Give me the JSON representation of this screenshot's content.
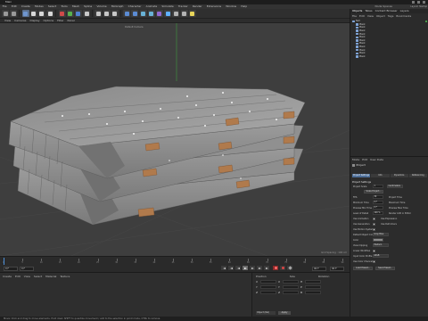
{
  "app": {
    "title": "Main",
    "window_controls": [
      "minimize",
      "maximize",
      "close"
    ]
  },
  "menubar": {
    "items": [
      "File",
      "Edit",
      "Create",
      "Modes",
      "Select",
      "Tools",
      "Mesh",
      "Spline",
      "Volume",
      "MoGraph",
      "Character",
      "Animate",
      "Simulate",
      "Tracker",
      "Render",
      "Extensions",
      "Window",
      "Help"
    ],
    "layout_label": "Node Spaces",
    "layout_value": "Layout: Startup"
  },
  "toolbar": {
    "tools": [
      {
        "name": "undo-icon",
        "color": "#9a9a9a"
      },
      {
        "name": "redo-icon",
        "color": "#9a9a9a"
      },
      {
        "name": "live-selection-icon",
        "color": "#6e95cf",
        "active": true
      },
      {
        "name": "move-icon",
        "color": "#d8d8d8"
      },
      {
        "name": "scale-icon",
        "color": "#d8d8d8"
      },
      {
        "name": "rotate-icon",
        "color": "#d8d8d8"
      },
      {
        "name": "x-axis-icon",
        "color": "#d04a4a"
      },
      {
        "name": "y-axis-icon",
        "color": "#58b14e"
      },
      {
        "name": "z-axis-icon",
        "color": "#4f7fd0"
      },
      {
        "name": "coordinate-system-icon",
        "color": "#c9c9c9"
      },
      {
        "name": "render-view-icon",
        "color": "#c7c7c7"
      },
      {
        "name": "render-picture-viewer-icon",
        "color": "#c7c7c7"
      },
      {
        "name": "render-settings-icon",
        "color": "#c7c7c7"
      },
      {
        "name": "cube-icon",
        "color": "#5b8bd3"
      },
      {
        "name": "pen-icon",
        "color": "#5b8bd3"
      },
      {
        "name": "subdivision-icon",
        "color": "#69b2d6"
      },
      {
        "name": "array-icon",
        "color": "#69b2d6"
      },
      {
        "name": "cloner-icon",
        "color": "#9268d0"
      },
      {
        "name": "deformer-icon",
        "color": "#5fb0ff"
      },
      {
        "name": "floor-icon",
        "color": "#b3b3b3"
      },
      {
        "name": "camera-icon",
        "color": "#b3b3b3"
      },
      {
        "name": "light-icon",
        "color": "#e8d55a"
      }
    ]
  },
  "viewport": {
    "menu": [
      "View",
      "Cameras",
      "Display",
      "Options",
      "Filter",
      "Panel"
    ],
    "camera_label": "Default Camera",
    "grid_spacing": "Grid Spacing : 100 cm",
    "background": "#3e3e3e"
  },
  "timeline": {
    "ticks": [
      "0",
      "5",
      "10",
      "15",
      "20",
      "25",
      "30",
      "35",
      "40",
      "45",
      "50",
      "55",
      "60",
      "65",
      "70",
      "75",
      "80",
      "85",
      "90"
    ],
    "current_frame": "0 F",
    "start_field": "0 F",
    "end_field": "90 F",
    "end_field2": "90 F",
    "start_field2": "0 F"
  },
  "lower": {
    "material_menu": [
      "Create",
      "Edit",
      "View",
      "Select",
      "Material",
      "Texture"
    ],
    "coord_headers": [
      "Position",
      "Size",
      "Rotation"
    ],
    "coord_rows": [
      [
        "X",
        "Y",
        "Z"
      ]
    ],
    "object_mode": "Object (Rel)",
    "apply_label": "Apply"
  },
  "status": {
    "text": "Move: Click and drag to move elements. Hold down SHIFT to quantize movement / add to the selection in point mode, CTRL to remove."
  },
  "right": {
    "tabs": [
      "Objects",
      "Takes",
      "Content Browser",
      "Layers"
    ],
    "obj_menu": [
      "File",
      "Edit",
      "View",
      "Object",
      "Tags",
      "Bookmarks"
    ],
    "objects": [
      "Null",
      "Plank",
      "Plank",
      "Plank",
      "Plank",
      "Plank",
      "Plank",
      "Plank",
      "Plank",
      "Plank",
      "Plank",
      "Plank"
    ],
    "attr_menu": [
      "Mode",
      "Edit",
      "User Data"
    ],
    "attr_title": "Project",
    "attr_tabs": [
      "Project Settings",
      "Info",
      "Dynamics",
      "Referencing"
    ],
    "section": "Project Settings",
    "settings": [
      {
        "label": "Project Scale",
        "value": "1",
        "unit": "Centimeters"
      },
      {
        "label": "Scale Project...",
        "button": true
      },
      {
        "label": "FPS",
        "value": "30",
        "right": "Project Time"
      },
      {
        "label": "Minimum Time",
        "value": "0 F",
        "right": "Maximum Time"
      },
      {
        "label": "Preview Min Time",
        "value": "0 F",
        "right": "Preview Max Time"
      },
      {
        "label": "Level of Detail",
        "value": "100 %",
        "right": "Render LOD in Editor"
      },
      {
        "label": "Use Animation",
        "check": true,
        "right": "Use Expression"
      },
      {
        "label": "Use Generators",
        "check": true,
        "right": "Use Deformers"
      },
      {
        "label": "Use Motion System",
        "check": true
      },
      {
        "label": "Default Object Color",
        "dropdown": "Gray Blue"
      },
      {
        "label": "Color",
        "swatch": true
      },
      {
        "label": "View Clipping",
        "dropdown": "Medium"
      },
      {
        "label": "Linear Workflow",
        "check": true
      },
      {
        "label": "Input Color Profile",
        "dropdown": "sRGB"
      },
      {
        "label": "Use Color Channel for Node Material",
        "check": true
      }
    ],
    "buttons": [
      "Load Preset...",
      "Save Preset..."
    ]
  }
}
